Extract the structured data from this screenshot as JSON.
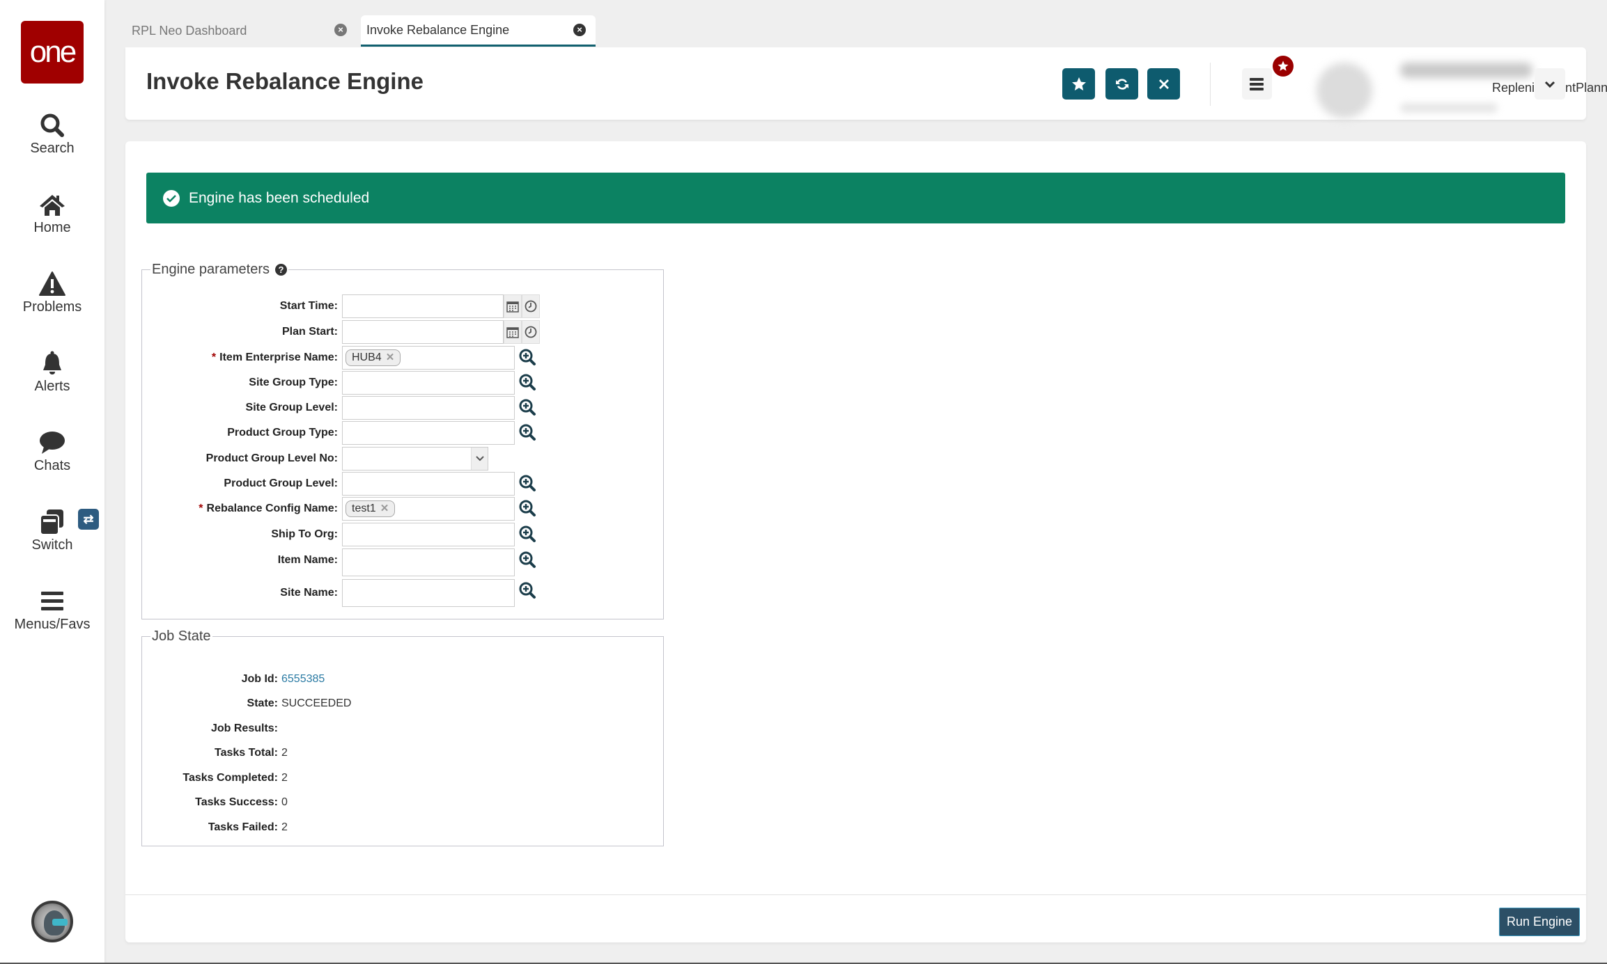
{
  "sidebar": {
    "logo_text": "one",
    "items": [
      {
        "label": "Search",
        "icon": "search-icon"
      },
      {
        "label": "Home",
        "icon": "home-icon"
      },
      {
        "label": "Problems",
        "icon": "warning-icon"
      },
      {
        "label": "Alerts",
        "icon": "bell-icon"
      },
      {
        "label": "Chats",
        "icon": "chat-bubble-icon"
      },
      {
        "label": "Switch",
        "icon": "switch-windows-icon"
      },
      {
        "label": "Menus/Favs",
        "icon": "hamburger-menu-icon"
      }
    ],
    "switch_badge_icon": "swap-arrows-icon",
    "bottom_avatar_icon": "ai-assistant-avatar"
  },
  "tabs": [
    {
      "label": "RPL Neo Dashboard",
      "active": false
    },
    {
      "label": "Invoke Rebalance Engine",
      "active": true
    }
  ],
  "header": {
    "title": "Invoke Rebalance Engine",
    "buttons": [
      {
        "name": "favorite",
        "icon": "star-icon"
      },
      {
        "name": "refresh",
        "icon": "refresh-icon"
      },
      {
        "name": "close",
        "icon": "close-icon"
      }
    ],
    "menu_icon": "hamburger-menu-icon",
    "menu_badge_icon": "star-icon",
    "user": {
      "role": "ReplenishmentPlanner"
    }
  },
  "banner": {
    "message": "Engine has been scheduled",
    "color": "#0c8262"
  },
  "engine_parameters": {
    "legend": "Engine parameters",
    "fields": [
      {
        "label": "Start Time:",
        "type": "datetime",
        "value": "",
        "required": false
      },
      {
        "label": "Plan Start:",
        "type": "datetime",
        "value": "",
        "required": false
      },
      {
        "label": "Item Enterprise Name:",
        "type": "lookup",
        "value": "HUB4",
        "required": true
      },
      {
        "label": "Site Group Type:",
        "type": "lookup",
        "value": "",
        "required": false
      },
      {
        "label": "Site Group Level:",
        "type": "lookup",
        "value": "",
        "required": false
      },
      {
        "label": "Product Group Type:",
        "type": "lookup",
        "value": "",
        "required": false
      },
      {
        "label": "Product Group Level No:",
        "type": "select",
        "value": "",
        "required": false
      },
      {
        "label": "Product Group Level:",
        "type": "lookup",
        "value": "",
        "required": false
      },
      {
        "label": "Rebalance Config Name:",
        "type": "lookup",
        "value": "test1",
        "required": true
      },
      {
        "label": "Ship To Org:",
        "type": "lookup",
        "value": "",
        "required": false
      },
      {
        "label": "Item Name:",
        "type": "lookup",
        "value": "",
        "required": false
      },
      {
        "label": "Site Name:",
        "type": "lookup",
        "value": "",
        "required": false
      }
    ],
    "required_marker": "*"
  },
  "job_state": {
    "legend": "Job State",
    "rows": [
      {
        "label": "Job Id:",
        "value": "6555385"
      },
      {
        "label": "State:",
        "value": "SUCCEEDED"
      },
      {
        "label": "Job Results:",
        "value": ""
      },
      {
        "label": "Tasks Total:",
        "value": "2"
      },
      {
        "label": "Tasks Completed:",
        "value": "2"
      },
      {
        "label": "Tasks Success:",
        "value": "0"
      },
      {
        "label": "Tasks Failed:",
        "value": "2"
      }
    ]
  },
  "footer": {
    "run_label": "Run Engine"
  },
  "colors": {
    "brand_red": "#a00000",
    "header_button": "#0e5b6e",
    "run_button": "#2c4f66",
    "link": "#2a7aa3"
  }
}
